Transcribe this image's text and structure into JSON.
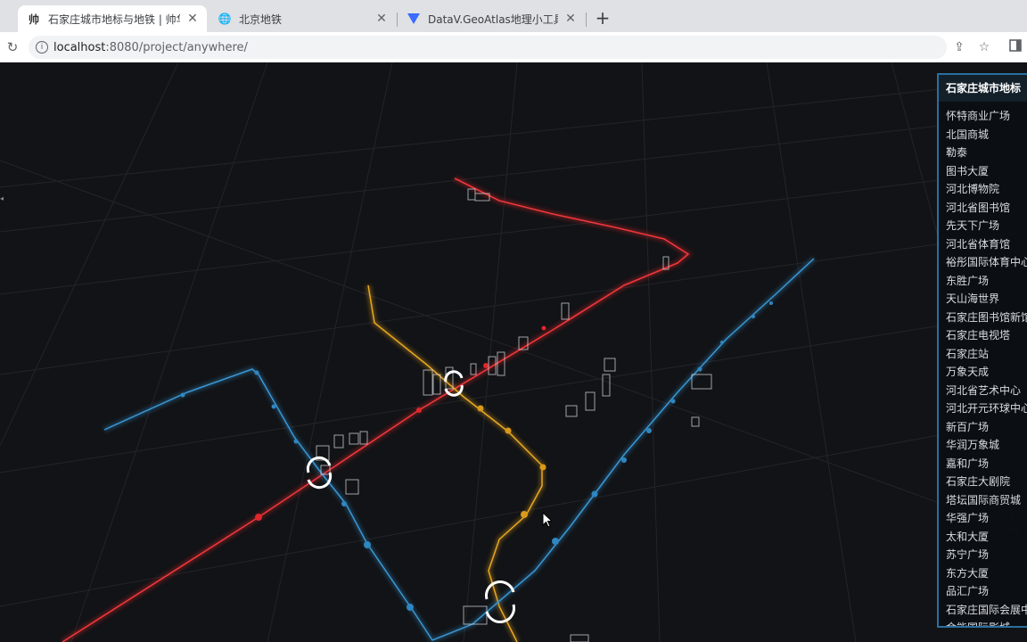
{
  "browser": {
    "tabs": [
      {
        "title": "石家庄城市地标与地铁 | 帅华君",
        "favicon": "app-favicon",
        "active": true
      },
      {
        "title": "北京地铁",
        "favicon": "globe-icon",
        "active": false
      },
      {
        "title": "DataV.GeoAtlas地理小工具系列",
        "favicon": "datav-favicon",
        "active": false
      }
    ],
    "url_host": "localhost",
    "url_rest": ":8080/project/anywhere/"
  },
  "panel": {
    "title": "石家庄城市地标",
    "items": [
      "怀特商业广场",
      "北国商城",
      "勒泰",
      "图书大厦",
      "河北博物院",
      "河北省图书馆",
      "先天下广场",
      "河北省体育馆",
      "裕彤国际体育中心",
      "东胜广场",
      "天山海世界",
      "石家庄图书馆新馆",
      "石家庄电视塔",
      "石家庄站",
      "万象天成",
      "河北省艺术中心",
      "河北开元环球中心",
      "新百广场",
      "华润万象城",
      "嘉和广场",
      "石家庄大剧院",
      "塔坛国际商贸城",
      "华强广场",
      "太和大厦",
      "苏宁广场",
      "东方大厦",
      "品汇广场",
      "石家庄国际会展中心",
      "金能国际影城"
    ]
  },
  "colors": {
    "line_red": "#e0262b",
    "line_blue": "#2f86c0",
    "line_yellow": "#d99a1a",
    "panel_accent": "#2a6fa0"
  }
}
